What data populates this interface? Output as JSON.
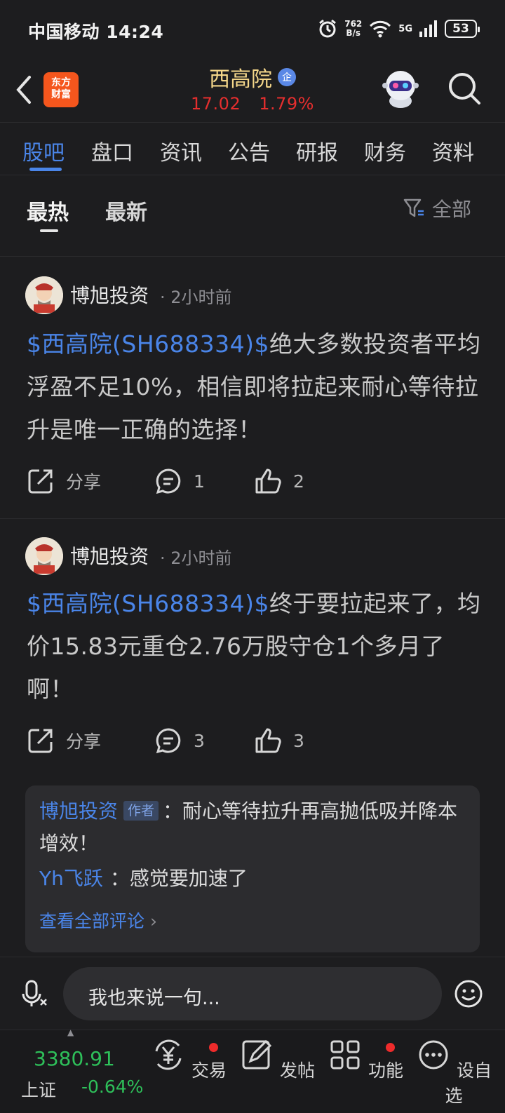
{
  "status": {
    "carrier": "中国移动",
    "time": "14:24",
    "netspeed": "762",
    "netspeed_unit": "B/s",
    "network": "5G",
    "battery": "53"
  },
  "header": {
    "logo_line1": "东方",
    "logo_line2": "财富",
    "stock_name": "西高院",
    "badge": "企",
    "price": "17.02",
    "change_pct": "1.79%"
  },
  "tabs": [
    "股吧",
    "盘口",
    "资讯",
    "公告",
    "研报",
    "财务",
    "资料"
  ],
  "sort": {
    "hot": "最热",
    "new": "最新",
    "filter": "全部"
  },
  "posts": [
    {
      "author": "博旭投资",
      "time": "· 2小时前",
      "tag": "$西高院(SH688334)$",
      "text": "绝大多数投资者平均浮盈不足10%，相信即将拉起来耐心等待拉升是唯一正确的选择！",
      "share": "分享",
      "comments": "1",
      "likes": "2"
    },
    {
      "author": "博旭投资",
      "time": "· 2小时前",
      "tag": "$西高院(SH688334)$",
      "text": "终于要拉起来了，均价15.83元重仓2.76万股守仓1个多月了啊！",
      "share": "分享",
      "comments": "3",
      "likes": "3"
    }
  ],
  "comments": [
    {
      "name": "博旭投资",
      "badge": "作者",
      "text": "：耐心等待拉升再高抛低吸并降本增效！"
    },
    {
      "name": "Yh飞跃",
      "text": "：感觉要加速了"
    }
  ],
  "view_all": "查看全部评论",
  "input_placeholder": "我也来说一句...",
  "index": {
    "value": "3380.91",
    "name": "上证",
    "change": "-0.64%"
  },
  "nav": [
    "交易",
    "发帖",
    "功能",
    "设自选"
  ],
  "colors": {
    "accent": "#4a85e8",
    "up": "#e52e2e",
    "down": "#2ec05a",
    "title": "#f5d78a"
  }
}
